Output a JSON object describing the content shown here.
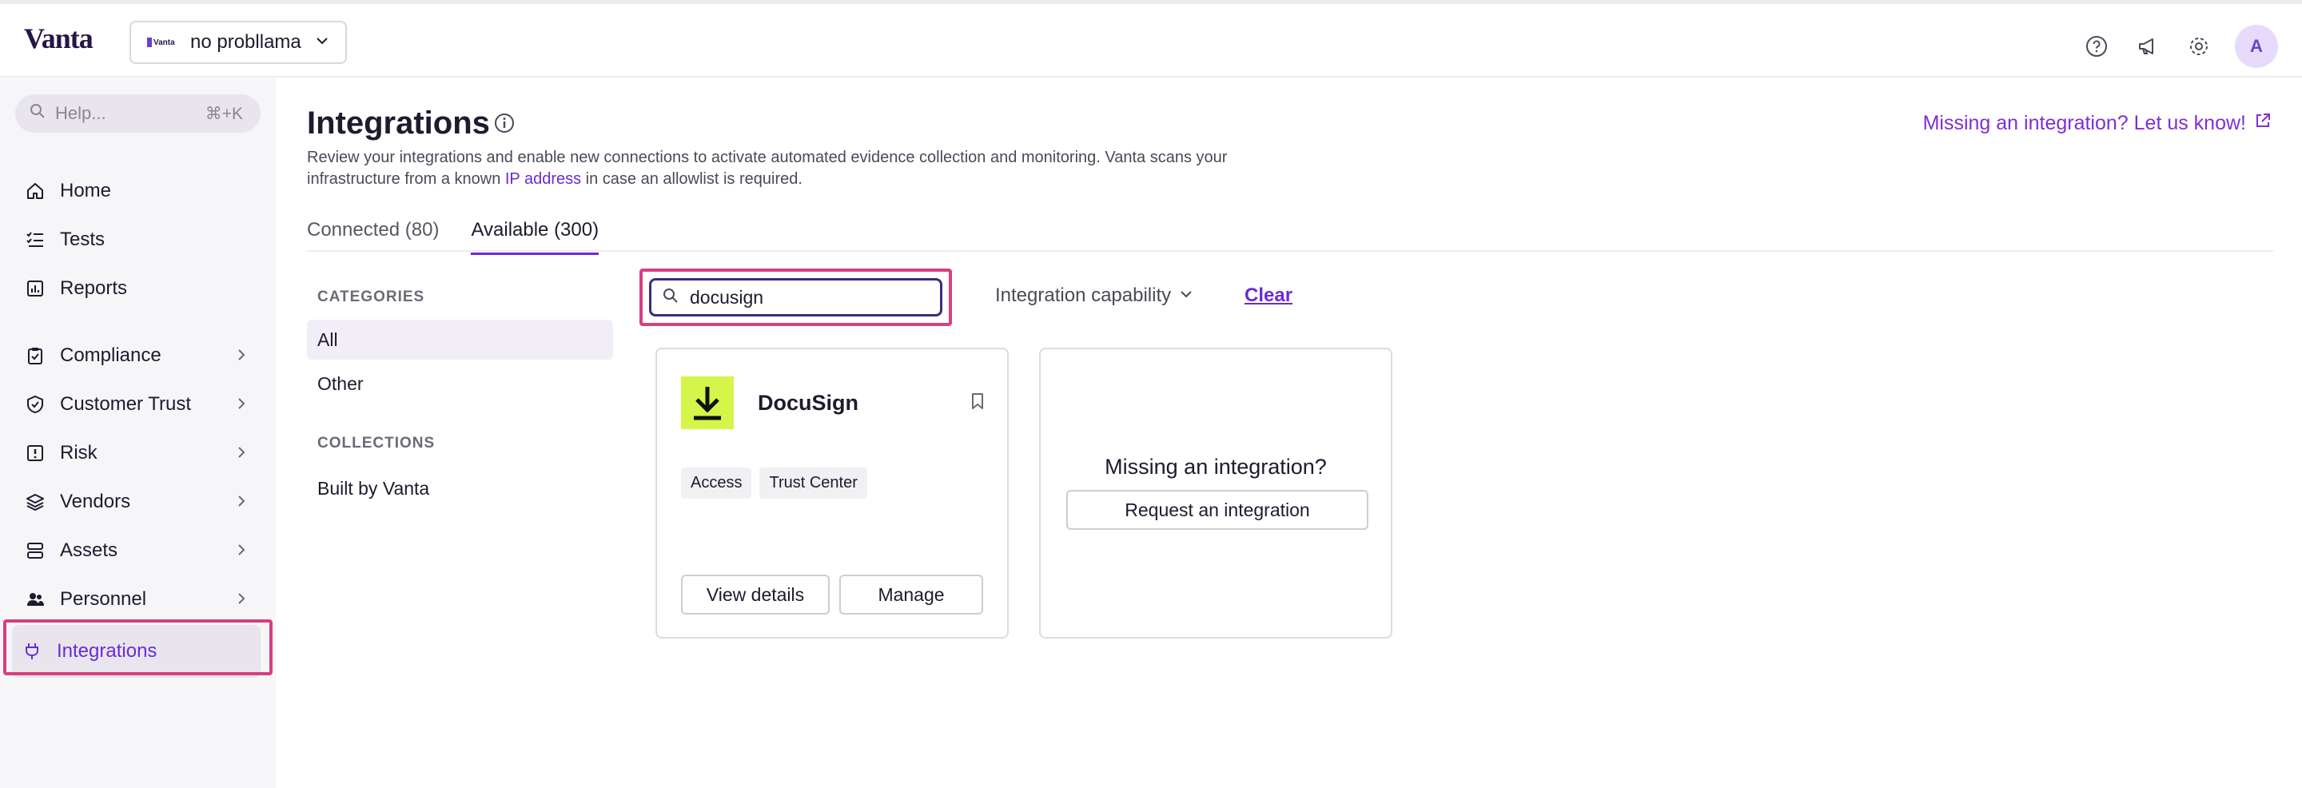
{
  "header": {
    "logo": "Vanta",
    "org": {
      "logo_text": "Vanta",
      "name": "no probllama"
    },
    "avatar_initial": "A",
    "icons": [
      "help-circle-icon",
      "megaphone-icon",
      "gear-icon"
    ]
  },
  "sidebar": {
    "search": {
      "placeholder": "Help...",
      "shortcut": "⌘+K"
    },
    "items": [
      {
        "label": "Home",
        "icon": "home-icon",
        "has_chevron": false
      },
      {
        "label": "Tests",
        "icon": "checklist-icon",
        "has_chevron": false
      },
      {
        "label": "Reports",
        "icon": "chart-icon",
        "has_chevron": false
      },
      {
        "label": "Compliance",
        "icon": "clipboard-check-icon",
        "has_chevron": true
      },
      {
        "label": "Customer Trust",
        "icon": "shield-check-icon",
        "has_chevron": true
      },
      {
        "label": "Risk",
        "icon": "alert-square-icon",
        "has_chevron": true
      },
      {
        "label": "Vendors",
        "icon": "stack-icon",
        "has_chevron": true
      },
      {
        "label": "Assets",
        "icon": "server-icon",
        "has_chevron": true
      },
      {
        "label": "Personnel",
        "icon": "people-icon",
        "has_chevron": true
      },
      {
        "label": "Integrations",
        "icon": "plug-icon",
        "has_chevron": false,
        "active": true
      }
    ]
  },
  "main": {
    "title": "Integrations",
    "missing_link": "Missing an integration? Let us know!",
    "description_before": "Review your integrations and enable new connections to activate automated evidence collection and monitoring. Vanta scans your infrastructure from a known ",
    "description_link": "IP address",
    "description_after": " in case an allowlist is required.",
    "tabs": [
      {
        "label": "Connected (80)",
        "selected": false
      },
      {
        "label": "Available (300)",
        "selected": true
      }
    ],
    "categories_heading": "CATEGORIES",
    "categories": [
      {
        "label": "All",
        "selected": true
      },
      {
        "label": "Other",
        "selected": false
      }
    ],
    "collections_heading": "COLLECTIONS",
    "collections": [
      {
        "label": "Built by Vanta"
      }
    ],
    "search": {
      "value": "docusign"
    },
    "capability_filter": "Integration capability",
    "clear": "Clear",
    "cards": [
      {
        "name": "DocuSign",
        "icon": "download-arrow-icon",
        "tags": [
          "Access",
          "Trust Center"
        ],
        "view_details": "View details",
        "manage": "Manage"
      }
    ],
    "missing_card": {
      "title": "Missing an integration?",
      "button": "Request an integration"
    }
  },
  "colors": {
    "accent": "#6b2ad6",
    "highlight": "#d63f80",
    "docusign_bg": "#d6f54a"
  }
}
